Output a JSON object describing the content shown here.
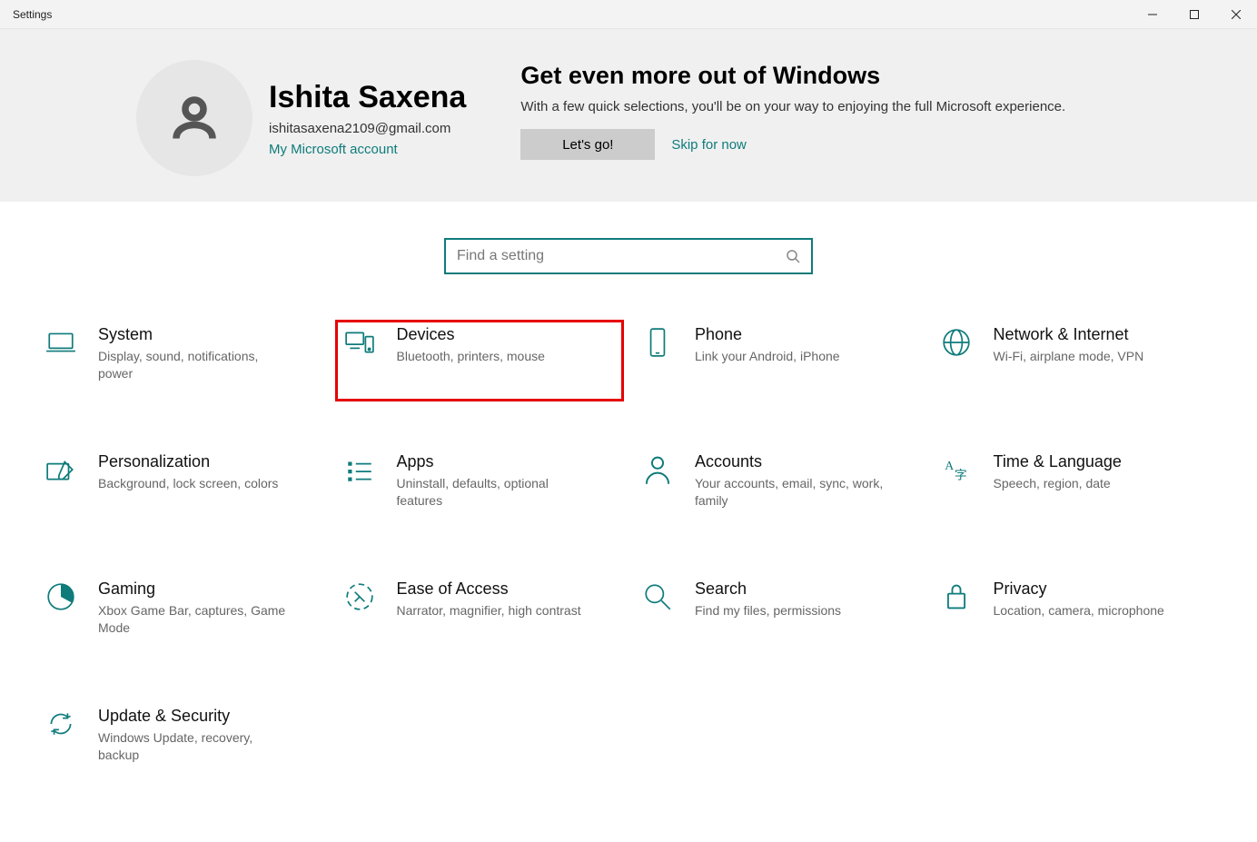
{
  "window": {
    "title": "Settings"
  },
  "profile": {
    "display_name": "Ishita Saxena",
    "email": "ishitasaxena2109@gmail.com",
    "account_link": "My Microsoft account"
  },
  "promo": {
    "heading": "Get even more out of Windows",
    "body": "With a few quick selections, you'll be on your way to enjoying the full Microsoft experience.",
    "cta": "Let's go!",
    "skip": "Skip for now"
  },
  "search": {
    "placeholder": "Find a setting"
  },
  "tiles": [
    {
      "id": "system",
      "label": "System",
      "desc": "Display, sound, notifications, power",
      "icon": "laptop-icon",
      "highlight": false
    },
    {
      "id": "devices",
      "label": "Devices",
      "desc": "Bluetooth, printers, mouse",
      "icon": "devices-icon",
      "highlight": true
    },
    {
      "id": "phone",
      "label": "Phone",
      "desc": "Link your Android, iPhone",
      "icon": "phone-icon",
      "highlight": false
    },
    {
      "id": "network",
      "label": "Network & Internet",
      "desc": "Wi-Fi, airplane mode, VPN",
      "icon": "globe-icon",
      "highlight": false
    },
    {
      "id": "personalization",
      "label": "Personalization",
      "desc": "Background, lock screen, colors",
      "icon": "pen-icon",
      "highlight": false
    },
    {
      "id": "apps",
      "label": "Apps",
      "desc": "Uninstall, defaults, optional features",
      "icon": "list-icon",
      "highlight": false
    },
    {
      "id": "accounts",
      "label": "Accounts",
      "desc": "Your accounts, email, sync, work, family",
      "icon": "user-icon",
      "highlight": false
    },
    {
      "id": "time",
      "label": "Time & Language",
      "desc": "Speech, region, date",
      "icon": "language-icon",
      "highlight": false
    },
    {
      "id": "gaming",
      "label": "Gaming",
      "desc": "Xbox Game Bar, captures, Game Mode",
      "icon": "gaming-icon",
      "highlight": false
    },
    {
      "id": "ease",
      "label": "Ease of Access",
      "desc": "Narrator, magnifier, high contrast",
      "icon": "ease-icon",
      "highlight": false
    },
    {
      "id": "search",
      "label": "Search",
      "desc": "Find my files, permissions",
      "icon": "search-big-icon",
      "highlight": false
    },
    {
      "id": "privacy",
      "label": "Privacy",
      "desc": "Location, camera, microphone",
      "icon": "lock-icon",
      "highlight": false
    },
    {
      "id": "update",
      "label": "Update & Security",
      "desc": "Windows Update, recovery, backup",
      "icon": "refresh-icon",
      "highlight": false
    }
  ],
  "colors": {
    "accent": "#0f7b7b",
    "highlight_border": "#e60000"
  }
}
